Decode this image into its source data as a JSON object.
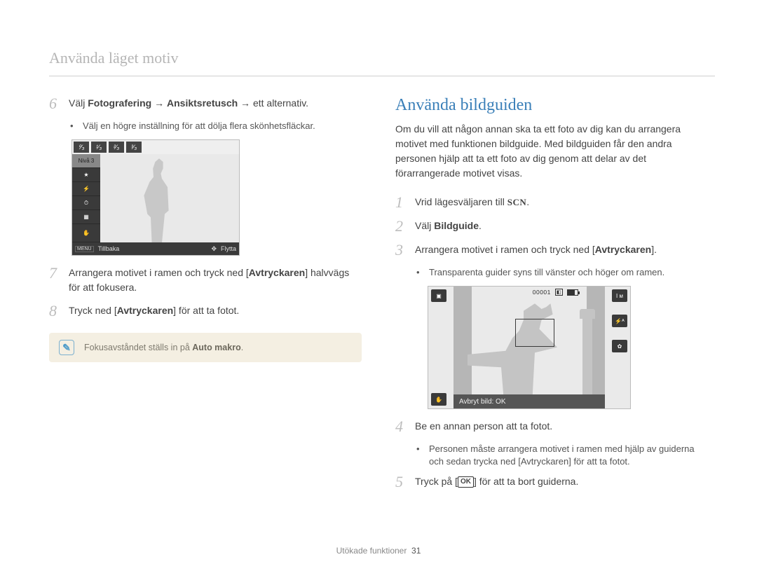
{
  "header": {
    "title": "Använda läget motiv"
  },
  "left": {
    "step6": {
      "prefix": "Välj ",
      "b1": "Fotografering",
      "arrow1": " → ",
      "b2": "Ansiktsretusch",
      "arrow2": " → ",
      "suffix": "ett alternativ."
    },
    "bullet6": "Välj en högre inställning för att dölja flera skönhetsfläckar.",
    "lcd": {
      "fractions": [
        "⁰⁄₃",
        "¹⁄₃",
        "²⁄₃",
        "³⁄₃"
      ],
      "level_label": "Nivå 3",
      "back_icon": "MENU",
      "back": "Tillbaka",
      "move_icon": "✥",
      "move": "Flytta"
    },
    "step7": {
      "t1": "Arrangera motivet i ramen och tryck ned [",
      "b": "Avtryckaren",
      "t2": "] halvvägs för att fokusera."
    },
    "step8": {
      "t1": "Tryck ned [",
      "b": "Avtryckaren",
      "t2": "] för att ta fotot."
    },
    "note": {
      "t1": "Fokusavståndet ställs in på ",
      "b": "Auto makro",
      "t2": "."
    }
  },
  "right": {
    "title": "Använda bildguiden",
    "intro": "Om du vill att någon annan ska ta ett foto av dig kan du arrangera motivet med funktionen bildguide. Med bildguiden får den andra personen hjälp att ta ett foto av dig genom att delar av det förarrangerade motivet visas.",
    "step1": {
      "t1": "Vrid lägesväljaren till ",
      "scn": "SCN",
      "t2": "."
    },
    "step2": {
      "t1": "Välj ",
      "b": "Bildguide",
      "t2": "."
    },
    "step3": {
      "t1": "Arrangera motivet i ramen och tryck ned [",
      "b": "Avtryckaren",
      "t2": "]."
    },
    "bullet3": "Transparenta guider syns till vänster och höger om ramen.",
    "lcd": {
      "counter": "00001",
      "bottom": "Avbryt bild: OK"
    },
    "step4": "Be en annan person att ta fotot.",
    "bullet4": {
      "t1": "Personen måste arrangera motivet i ramen med hjälp av guiderna och sedan trycka ned [",
      "b": "Avtryckaren",
      "t2": "] för att ta fotot."
    },
    "step5": {
      "t1": "Tryck på [",
      "ok": "OK",
      "t2": "] för att ta bort guiderna."
    }
  },
  "footer": {
    "label": "Utökade funktioner",
    "page": "31"
  }
}
